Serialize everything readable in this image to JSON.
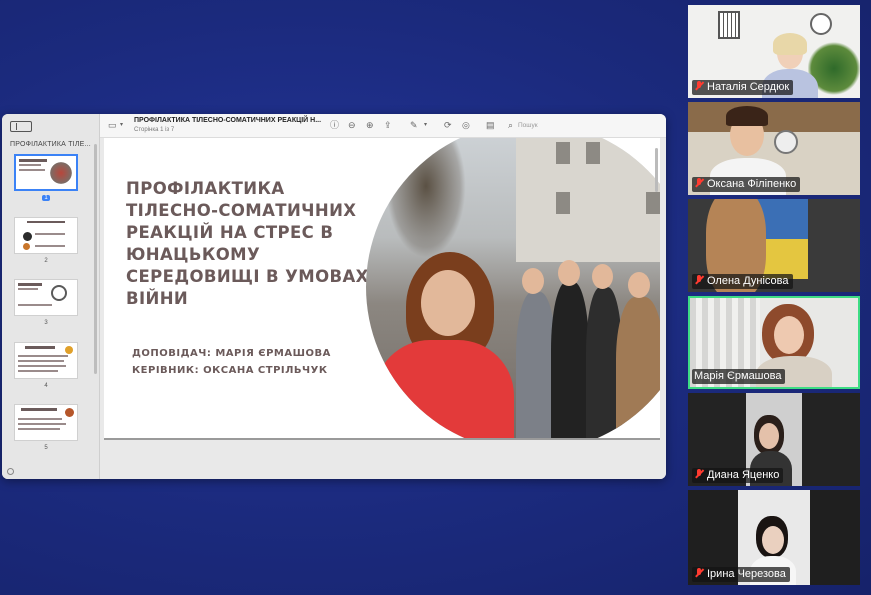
{
  "preview": {
    "sidebar_title": "ПРОФІЛАКТИКА ТІЛЕ...",
    "doc_title": "ПРОФІЛАКТИКА ТІЛЕСНО-СОМАТИЧНИХ РЕАКЦІЙ Н...",
    "doc_subtitle": "Сторінка 1 із 7",
    "search_placeholder": "Пошук",
    "pages": [
      "1",
      "2",
      "3",
      "4",
      "5"
    ],
    "selected_page": "1"
  },
  "slide": {
    "title": "ПРОФІЛАКТИКА ТІЛЕСНО-СОМАТИЧНИХ РЕАКЦІЙ НА СТРЕС В ЮНАЦЬКОМУ СЕРЕДОВИЩІ В УМОВАХ ВІЙНИ",
    "presenter_line": "ДОПОВІДАЧ: МАРІЯ ЄРМАШОВА",
    "supervisor_line": "КЕРІВНИК: ОКСАНА СТРІЛЬЧУК"
  },
  "participants": [
    {
      "name": "Наталія Сердюк",
      "muted": true
    },
    {
      "name": "Оксана Філіпенко",
      "muted": true
    },
    {
      "name": "Олена Дунісова",
      "muted": true
    },
    {
      "name": "Марія Єрмашова",
      "muted": false,
      "active_speaker": true
    },
    {
      "name": "Диана Яценко",
      "muted": true
    },
    {
      "name": "Ірина Черезова",
      "muted": true
    }
  ],
  "colors": {
    "background": "#1b2a7d",
    "slide_text": "#6b5a5a",
    "active_border": "#3ddc84",
    "muted_icon": "#ff3b30"
  }
}
